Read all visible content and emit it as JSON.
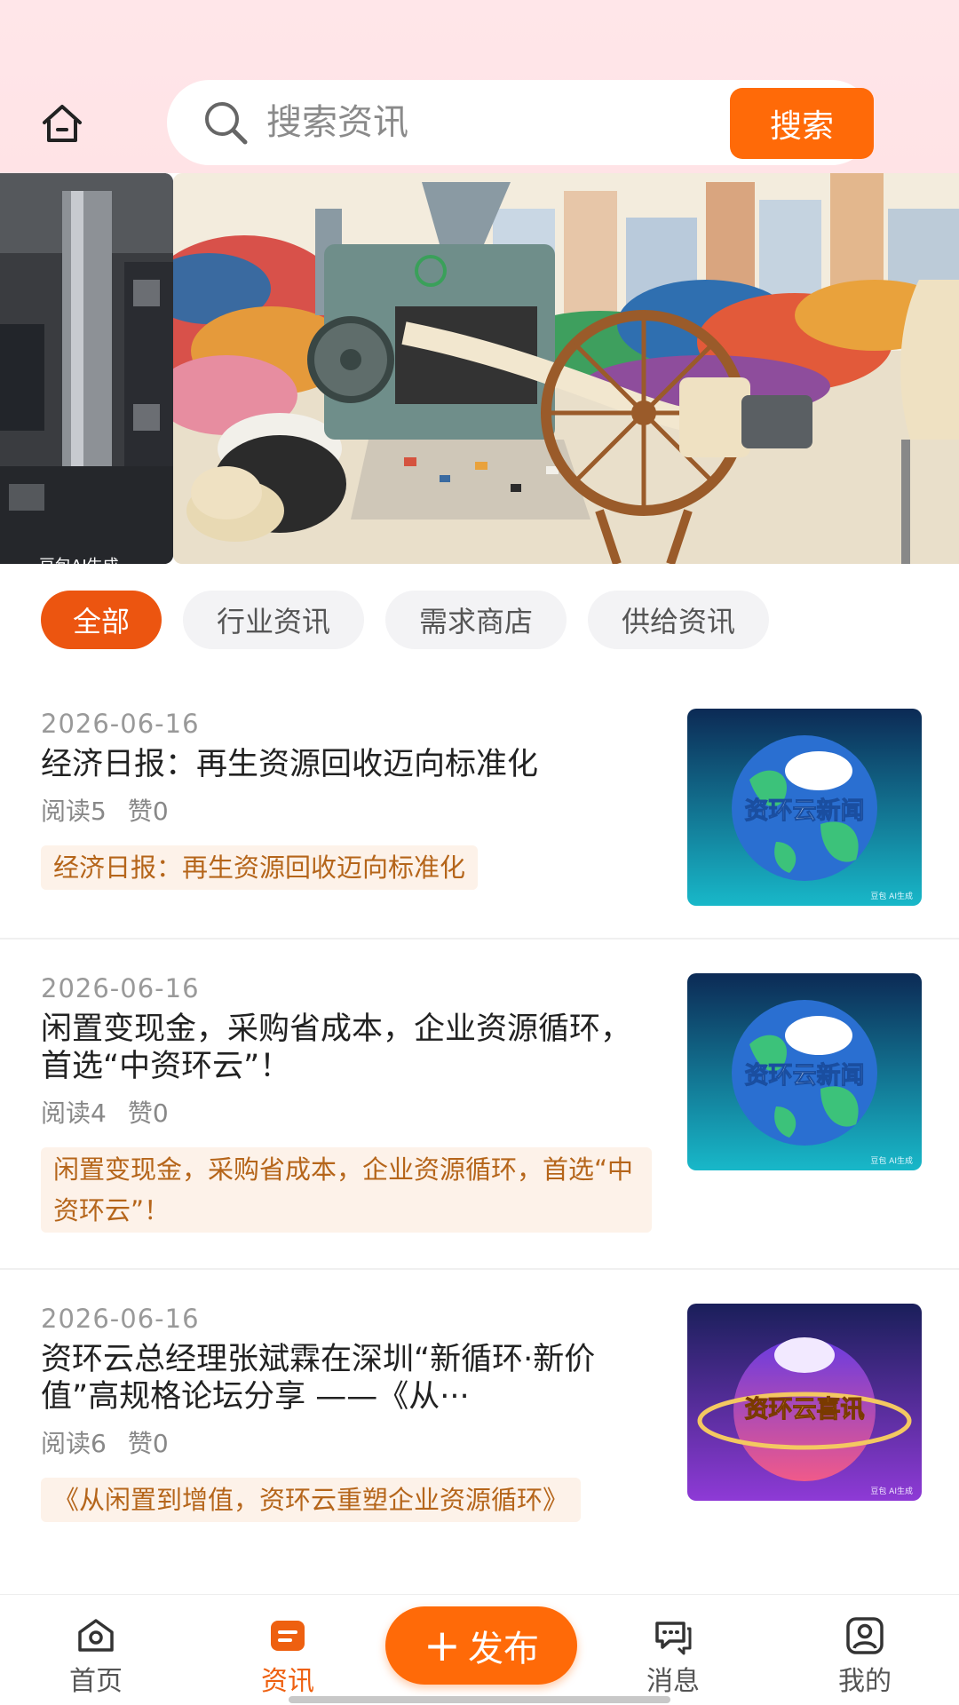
{
  "header": {
    "home_icon": "home-icon",
    "search": {
      "placeholder": "搜索资讯",
      "button_label": "搜索",
      "icon": "search-icon"
    }
  },
  "banner": {
    "caption": "豆包AI生成",
    "colors": {
      "accent": "#ff6a08"
    }
  },
  "tabs": [
    {
      "label": "全部",
      "active": true
    },
    {
      "label": "行业资讯",
      "active": false
    },
    {
      "label": "需求商店",
      "active": false
    },
    {
      "label": "供给资讯",
      "active": false
    }
  ],
  "news": [
    {
      "date": "2026-06-16",
      "title": "经济日报：再生资源回收迈向标准化",
      "reads": "阅读5",
      "likes": "赞0",
      "tag": "经济日报：再生资源回收迈向标准化",
      "thumb_text": "资环云新闻",
      "thumb_watermark": "豆包 AI生成"
    },
    {
      "date": "2026-06-16",
      "title": "闲置变现金，采购省成本，企业资源循环，首选“中资环云”！",
      "reads": "阅读4",
      "likes": "赞0",
      "tag": "闲置变现金，采购省成本，企业资源循环，首选“中资环云”！",
      "thumb_text": "资环云新闻",
      "thumb_watermark": "豆包 AI生成"
    },
    {
      "date": "2026-06-16",
      "title": "资环云总经理张斌霖在深圳“新循环·新价值”高规格论坛分享 ——《从···",
      "reads": "阅读6",
      "likes": "赞0",
      "tag": "《从闲置到增值，资环云重塑企业资源循环》",
      "thumb_text": "资环云喜讯",
      "thumb_watermark": "豆包 AI生成"
    }
  ],
  "bottom_nav": {
    "home": "首页",
    "news": "资讯",
    "publish": "发布",
    "messages": "消息",
    "mine": "我的",
    "active": "news",
    "active_color": "#ee6010"
  }
}
